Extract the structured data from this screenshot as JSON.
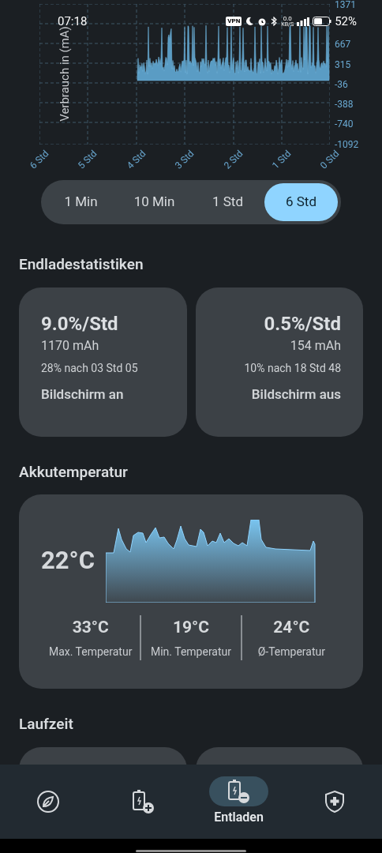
{
  "status_bar": {
    "time": "07:18",
    "vpn": "VPN",
    "speed": "0.0",
    "speed_unit": "KB/S",
    "battery": "52%"
  },
  "usage_chart": {
    "ylabel": "Verbrauch in (mA)",
    "yticks": [
      "1371",
      "667",
      "315",
      "-36",
      "-388",
      "-740",
      "-1092"
    ],
    "xticks": [
      "6 Std",
      "5 Std",
      "4 Std",
      "3 Std",
      "2 Std",
      "1 Std",
      "0 Std"
    ]
  },
  "range": [
    {
      "label": "1 Min",
      "selected": false
    },
    {
      "label": "10 Min",
      "selected": false
    },
    {
      "label": "1 Std",
      "selected": false
    },
    {
      "label": "6 Std",
      "selected": true
    }
  ],
  "discharge": {
    "title": "Endladestatistiken",
    "cards": [
      {
        "rate": "9.0%/Std",
        "capacity": "1170 mAh",
        "estimate": "28% nach 03 Std 05",
        "label": "Bildschirm an"
      },
      {
        "rate": "0.5%/Std",
        "capacity": "154 mAh",
        "estimate": "10% nach 18 Std 48",
        "label": "Bildschirm aus"
      }
    ]
  },
  "temperature": {
    "title": "Akkutemperatur",
    "current": "22°C",
    "stats": [
      {
        "value": "33°C",
        "label": "Max. Temperatur"
      },
      {
        "value": "19°C",
        "label": "Min. Temperatur"
      },
      {
        "value": "24°C",
        "label": "Ø-Temperatur"
      }
    ]
  },
  "runtime": {
    "title": "Laufzeit"
  },
  "nav": [
    {
      "kind": "leaf",
      "selected": false
    },
    {
      "kind": "charge",
      "selected": false
    },
    {
      "kind": "discharge",
      "selected": true,
      "label": "Entladen"
    },
    {
      "kind": "shield",
      "selected": false
    }
  ]
}
